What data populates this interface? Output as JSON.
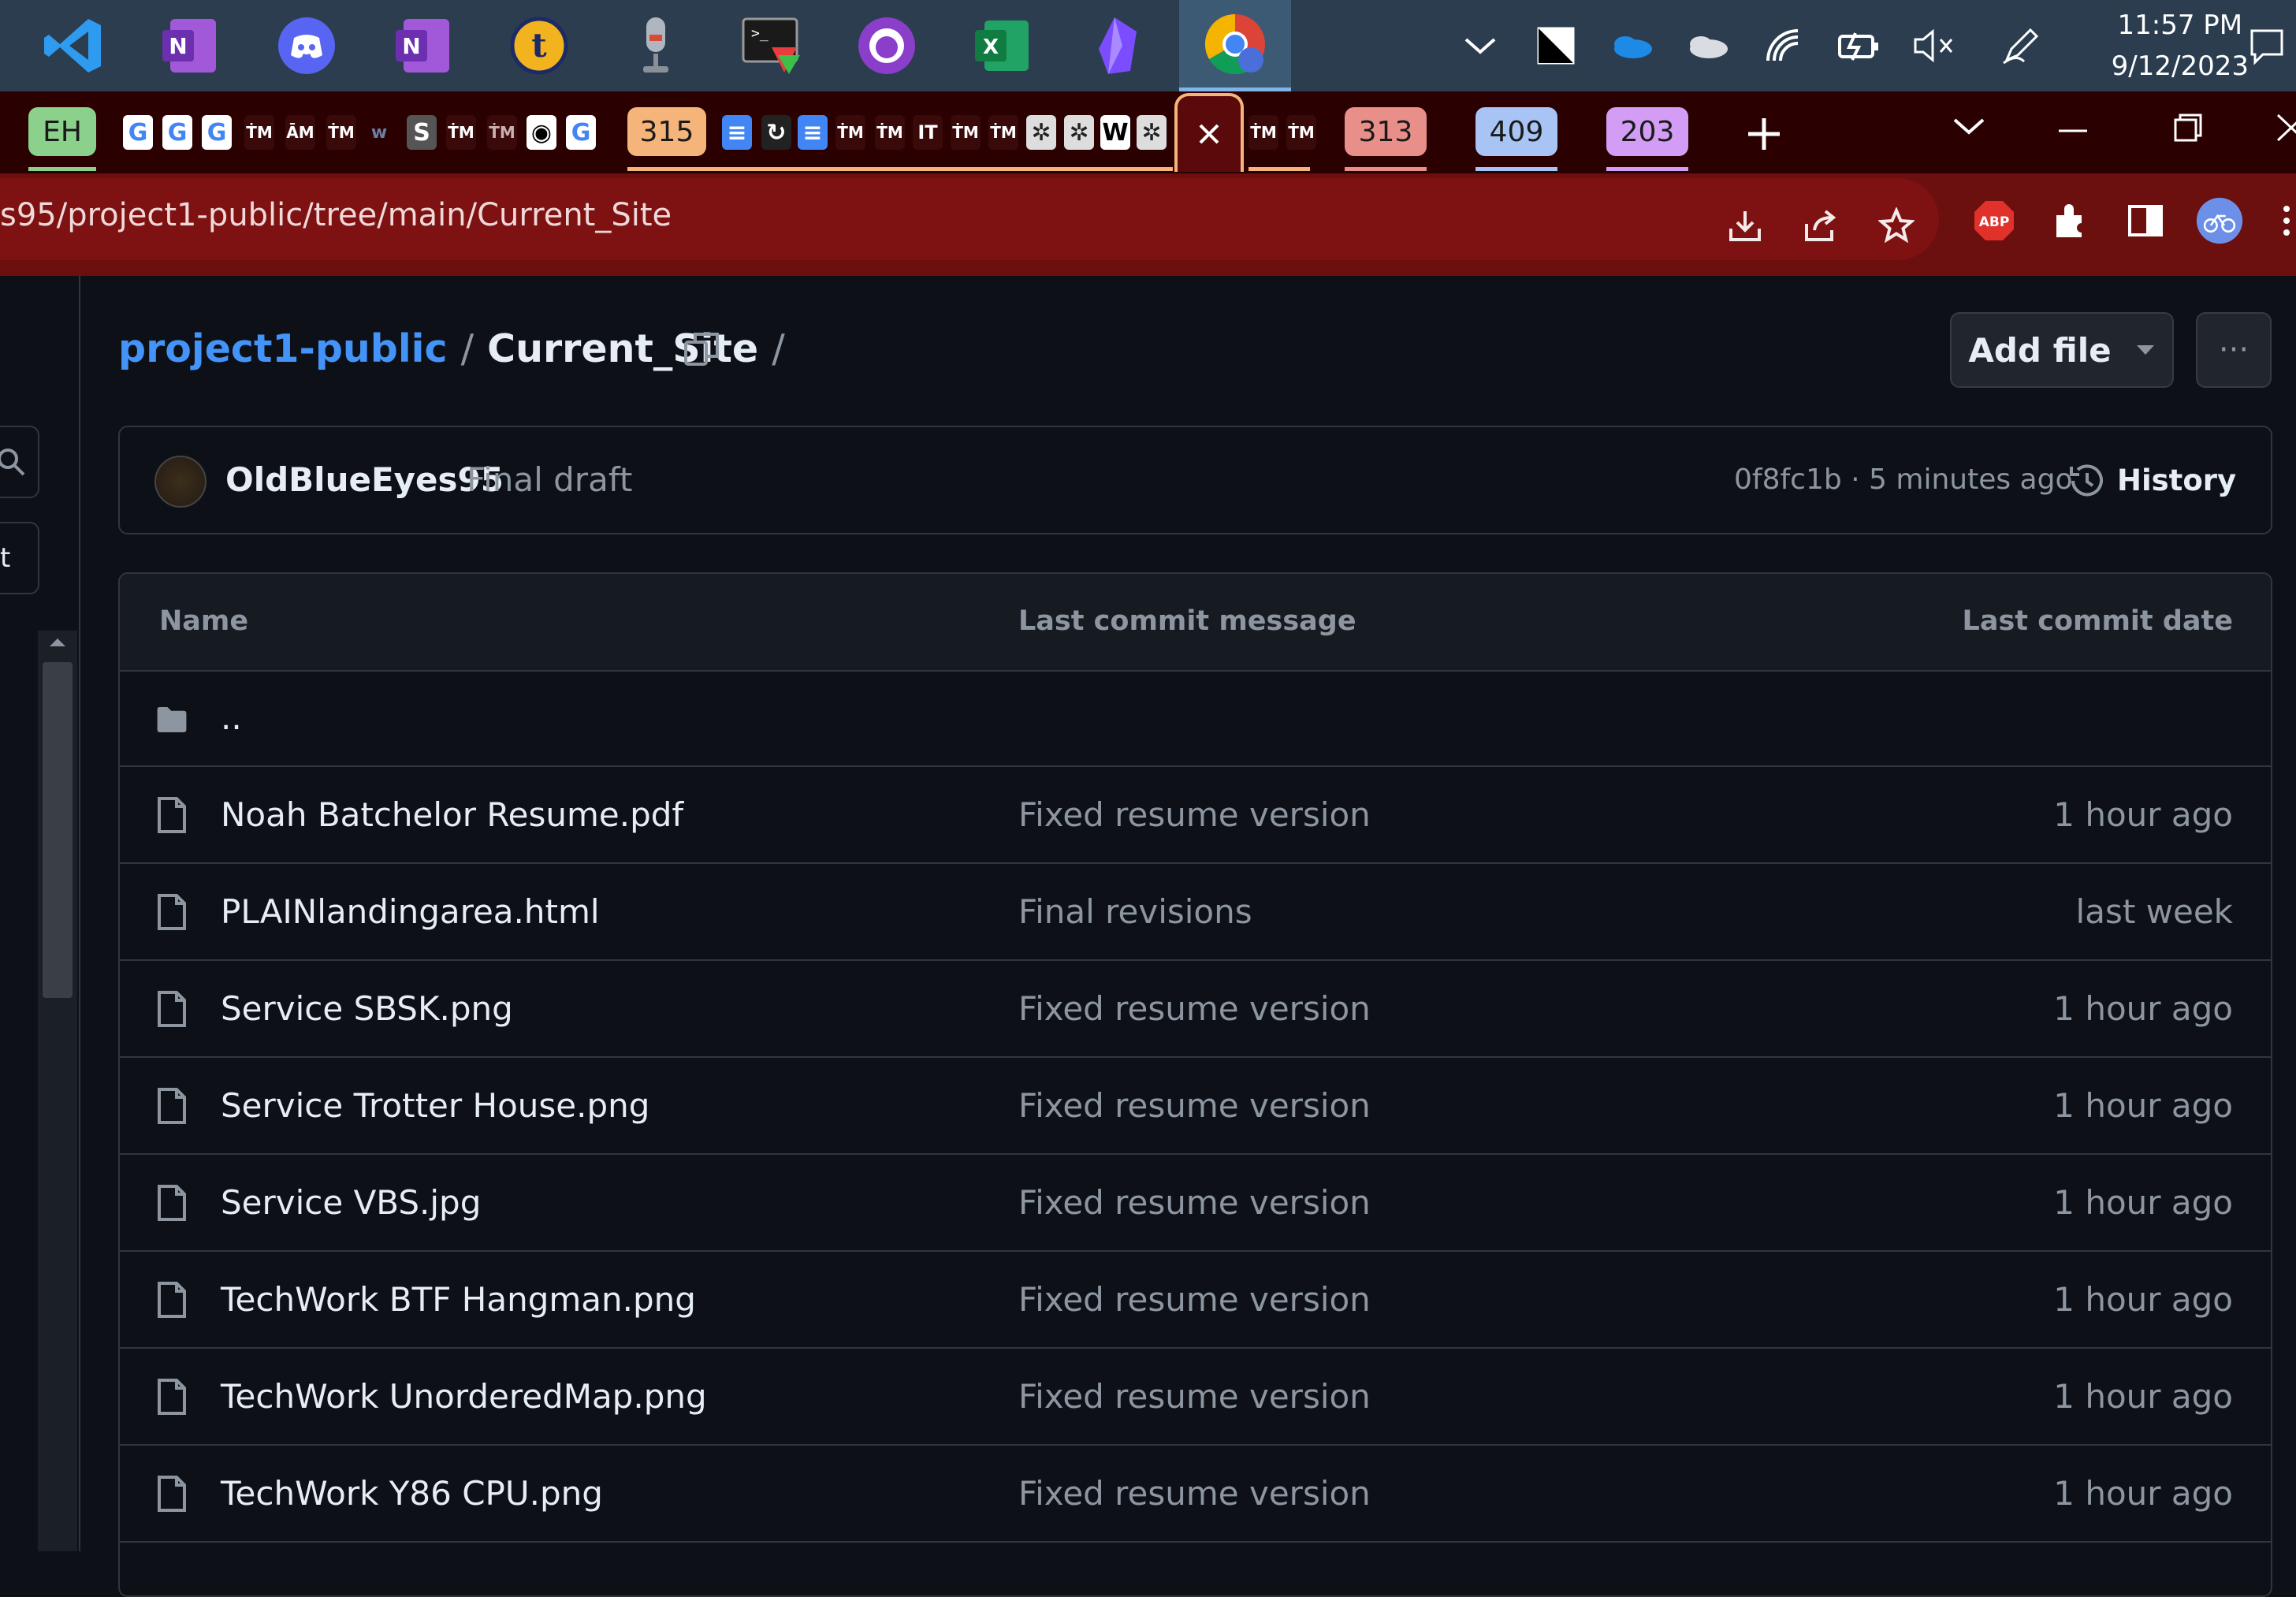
{
  "taskbar": {
    "apps": [
      "vscode-icon",
      "onenote-icon",
      "discord-icon",
      "onenote-icon",
      "t-app-icon",
      "microphone-icon",
      "terminal-icon",
      "github-desktop-icon",
      "excel-icon",
      "obsidian-icon",
      "chrome-icon"
    ],
    "clock_time": "11:57 PM",
    "clock_date": "9/12/2023"
  },
  "tabs": {
    "group_eh": "EH",
    "group_315": "315",
    "group_313": "313",
    "group_409": "409",
    "group_203": "203",
    "colors": {
      "eh": "#8bd08b",
      "g315": "#f5b47a",
      "g313": "#e88f8a",
      "g409": "#a7c4f5",
      "g203": "#d39cf5"
    }
  },
  "omnibox": {
    "url": "s95/project1-public/tree/main/Current_Site",
    "abp_label": "ABP"
  },
  "repo": {
    "breadcrumb_repo": "project1-public",
    "breadcrumb_sep": "/",
    "breadcrumb_folder": "Current_Site",
    "add_file_label": "Add file",
    "more_label": "···"
  },
  "commit": {
    "author": "OldBlueEyes95",
    "message": "Final draft",
    "sha_time": "0f8fc1b · 5 minutes ago",
    "history_label": "History"
  },
  "table": {
    "header_name": "Name",
    "header_message": "Last commit message",
    "header_date": "Last commit date",
    "parent": "..",
    "files": [
      {
        "name": "Noah Batchelor Resume.pdf",
        "message": "Fixed resume version",
        "date": "1 hour ago"
      },
      {
        "name": "PLAINlandingarea.html",
        "message": "Final revisions",
        "date": "last week"
      },
      {
        "name": "Service SBSK.png",
        "message": "Fixed resume version",
        "date": "1 hour ago"
      },
      {
        "name": "Service Trotter House.png",
        "message": "Fixed resume version",
        "date": "1 hour ago"
      },
      {
        "name": "Service VBS.jpg",
        "message": "Fixed resume version",
        "date": "1 hour ago"
      },
      {
        "name": "TechWork BTF Hangman.png",
        "message": "Fixed resume version",
        "date": "1 hour ago"
      },
      {
        "name": "TechWork UnorderedMap.png",
        "message": "Fixed resume version",
        "date": "1 hour ago"
      },
      {
        "name": "TechWork Y86 CPU.png",
        "message": "Fixed resume version",
        "date": "1 hour ago"
      }
    ]
  },
  "left_rail": {
    "partial_button_label": "t"
  }
}
